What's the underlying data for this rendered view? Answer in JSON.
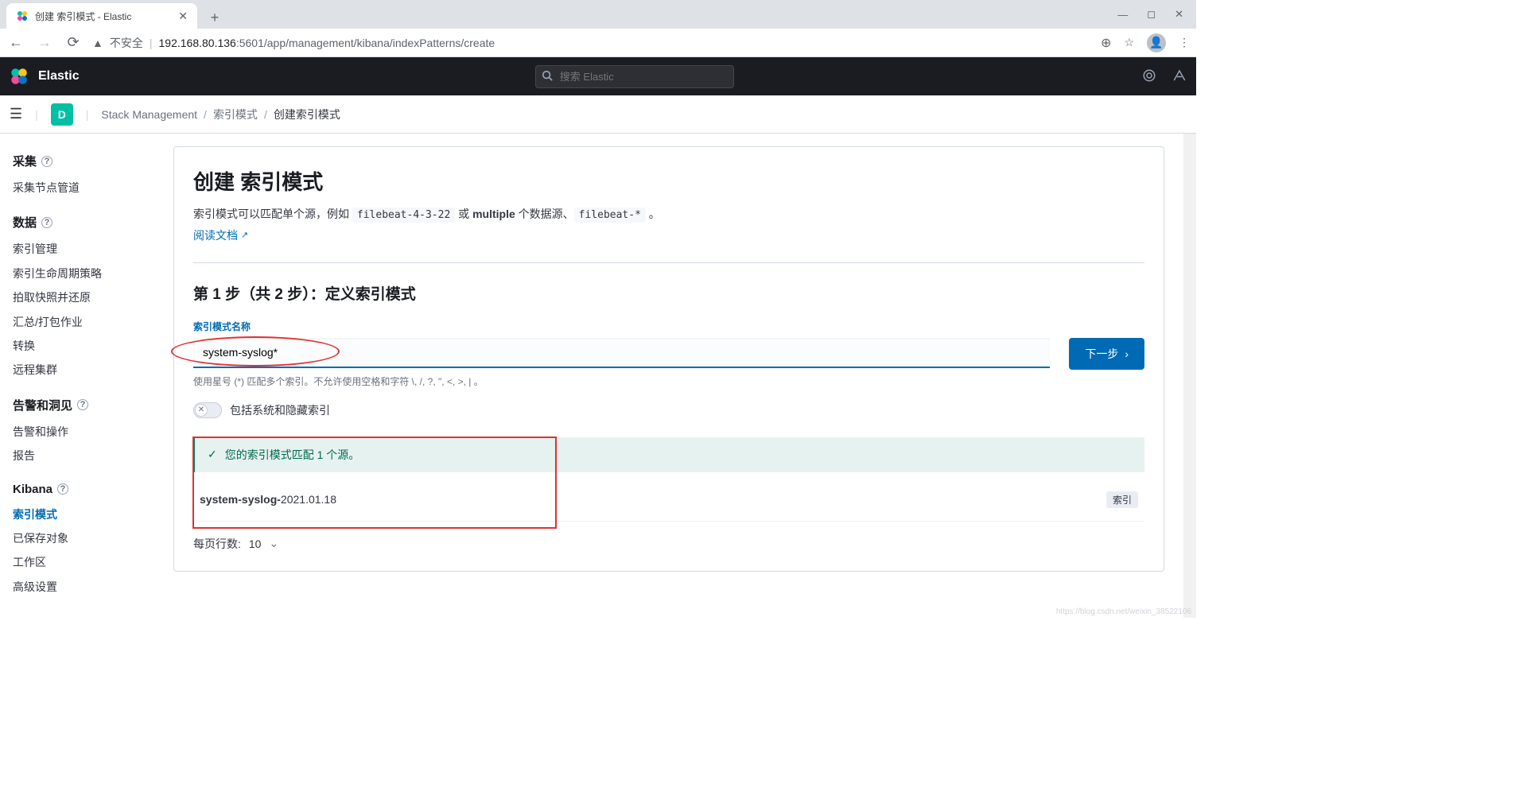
{
  "browser": {
    "tab_title": "创建 索引模式 - Elastic",
    "insecure_label": "不安全",
    "url_host": "192.168.80.136",
    "url_port_path": ":5601/app/management/kibana/indexPatterns/create"
  },
  "header": {
    "brand": "Elastic",
    "search_placeholder": "搜索 Elastic"
  },
  "subheader": {
    "space_letter": "D",
    "crumb1": "Stack Management",
    "crumb2": "索引模式",
    "crumb3": "创建索引模式"
  },
  "sidebar": {
    "section1_title": "采集",
    "section1_items": [
      "采集节点管道"
    ],
    "section2_title": "数据",
    "section2_items": [
      "索引管理",
      "索引生命周期策略",
      "拍取快照并还原",
      "汇总/打包作业",
      "转换",
      "远程集群"
    ],
    "section3_title": "告警和洞见",
    "section3_items": [
      "告警和操作",
      "报告"
    ],
    "section4_title": "Kibana",
    "section4_items": [
      "索引模式",
      "已保存对象",
      "工作区",
      "高级设置"
    ],
    "section4_active_index": 0
  },
  "main": {
    "title": "创建 索引模式",
    "desc_pre": "索引模式可以匹配单个源，例如 ",
    "desc_code1": "filebeat-4-3-22",
    "desc_mid": " 或 ",
    "desc_bold": "multiple",
    "desc_mid2": " 个数据源、",
    "desc_code2": "filebeat-*",
    "desc_post": " 。",
    "doc_link": "阅读文档",
    "step_title": "第 1 步（共 2 步）：定义索引模式",
    "field_label": "索引模式名称",
    "pattern_value": "system-syslog*",
    "hint": "使用星号 (*) 匹配多个索引。不允许使用空格和字符 \\, /, ?, \", <, >, | 。",
    "next_button": "下一步",
    "toggle_label": "包括系统和隐藏索引",
    "callout_text": "您的索引模式匹配 1 个源。",
    "match_bold": "system-syslog-",
    "match_rest": "2021.01.18",
    "match_badge": "索引",
    "pager_label": "每页行数:",
    "pager_value": "10"
  },
  "watermark": "https://blog.csdn.net/weixin_38522106"
}
